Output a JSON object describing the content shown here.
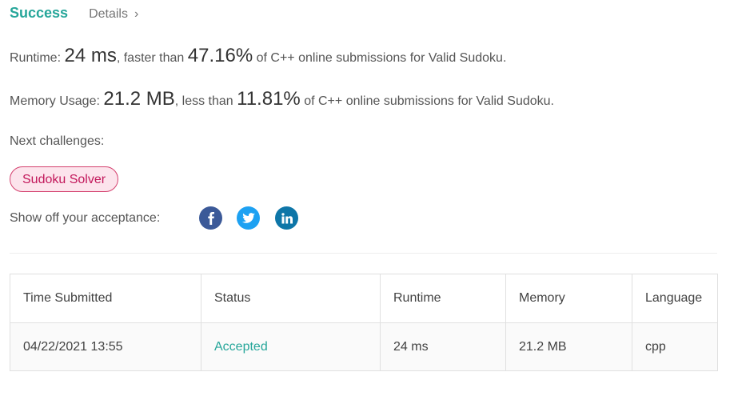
{
  "header": {
    "status": "Success",
    "details_label": "Details",
    "details_chevron": "›"
  },
  "runtime_line": {
    "prefix": "Runtime: ",
    "value": "24 ms",
    "mid": ", faster than ",
    "percent": "47.16%",
    "suffix": " of C++ online submissions for Valid Sudoku."
  },
  "memory_line": {
    "prefix": "Memory Usage: ",
    "value": "21.2 MB",
    "mid": ", less than ",
    "percent": "11.81%",
    "suffix": " of C++ online submissions for Valid Sudoku."
  },
  "next": {
    "label": "Next challenges:",
    "challenges": [
      "Sudoku Solver"
    ]
  },
  "share": {
    "label": "Show off your acceptance:",
    "icons": [
      "facebook-icon",
      "twitter-icon",
      "linkedin-icon"
    ],
    "colors": {
      "facebook": "#3b5998",
      "twitter": "#1da1f2",
      "linkedin": "#0e76a8"
    }
  },
  "table": {
    "headers": [
      "Time Submitted",
      "Status",
      "Runtime",
      "Memory",
      "Language"
    ],
    "rows": [
      [
        "04/22/2021 13:55",
        "Accepted",
        "24 ms",
        "21.2 MB",
        "cpp"
      ]
    ]
  },
  "colors": {
    "success": "#26a69a",
    "tag_border": "#d4406e",
    "tag_bg": "#fce4ec"
  }
}
